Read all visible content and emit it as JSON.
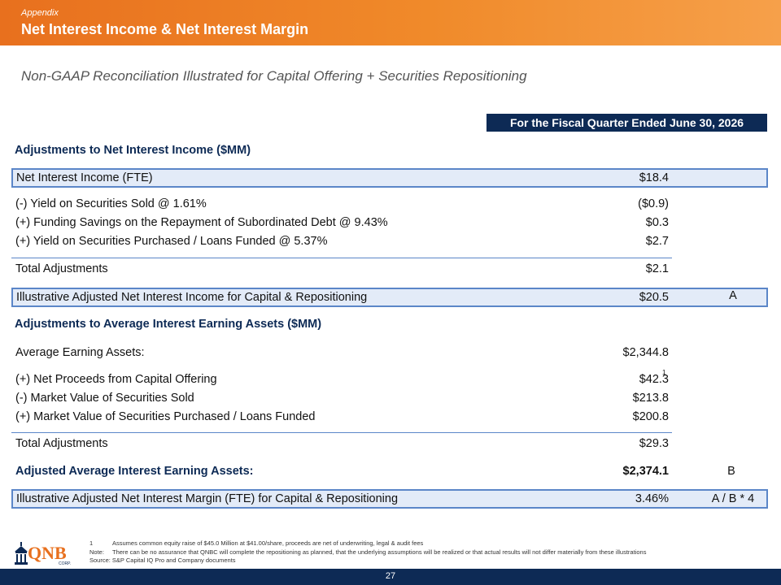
{
  "header": {
    "kicker": "Appendix",
    "title": "Net Interest Income & Net Interest Margin"
  },
  "subtitle": "Non-GAAP Reconciliation Illustrated for Capital Offering + Securities Repositioning",
  "period_label": "For the Fiscal Quarter Ended June 30, 2026",
  "nii": {
    "heading": "Adjustments to Net Interest Income ($MM)",
    "base": {
      "label": "Net Interest Income (FTE)",
      "value": "$18.4"
    },
    "items": [
      {
        "label": "(-) Yield on Securities Sold @ 1.61%",
        "value": "($0.9)"
      },
      {
        "label": "(+) Funding Savings on the Repayment of Subordinated Debt @ 9.43%",
        "value": "$0.3"
      },
      {
        "label": "(+) Yield on Securities Purchased / Loans Funded @ 5.37%",
        "value": "$2.7"
      }
    ],
    "total": {
      "label": "Total Adjustments",
      "value": "$2.1"
    },
    "adjusted": {
      "label": "Illustrative Adjusted Net Interest Income for Capital & Repositioning",
      "value": "$20.5",
      "ref": "A"
    }
  },
  "aiea": {
    "heading": "Adjustments to Average Interest Earning Assets ($MM)",
    "base": {
      "label": "Average Earning Assets:",
      "value": "$2,344.8"
    },
    "items": [
      {
        "label": "(+) Net Proceeds from Capital Offering",
        "value": "$42.3",
        "footnote": "1"
      },
      {
        "label": "(-) Market Value of Securities Sold",
        "value": "$213.8"
      },
      {
        "label": "(+) Market Value of Securities Purchased / Loans Funded",
        "value": "$200.8"
      }
    ],
    "total": {
      "label": "Total Adjustments",
      "value": "$29.3"
    },
    "adjusted": {
      "label": "Adjusted Average Interest Earning Assets:",
      "value": "$2,374.1",
      "ref": "B"
    }
  },
  "nim": {
    "label": "Illustrative Adjusted Net Interest Margin (FTE) for Capital & Repositioning",
    "value": "3.46%",
    "ref": "A / B * 4"
  },
  "footnotes": {
    "n1_marker": "1",
    "n1_text": "Assumes common equity raise of $45.0 Million at $41.00/share, proceeds are net of underwriting, legal & audit fees",
    "note_marker": "Note:",
    "note_text": "There can be no assurance that QNBC will complete the repositioning as planned, that the underlying assumptions will be realized or that actual results will not differ materially from these illustrations",
    "source": "Source: S&P Capital IQ Pro and Company documents"
  },
  "logo": {
    "text": "QNB",
    "sub": "CORP."
  },
  "page_number": "27",
  "colors": {
    "orange": "#e8701e",
    "navy": "#0d2a55",
    "box_border": "#5b86c8",
    "box_fill": "#e3ebf8"
  }
}
